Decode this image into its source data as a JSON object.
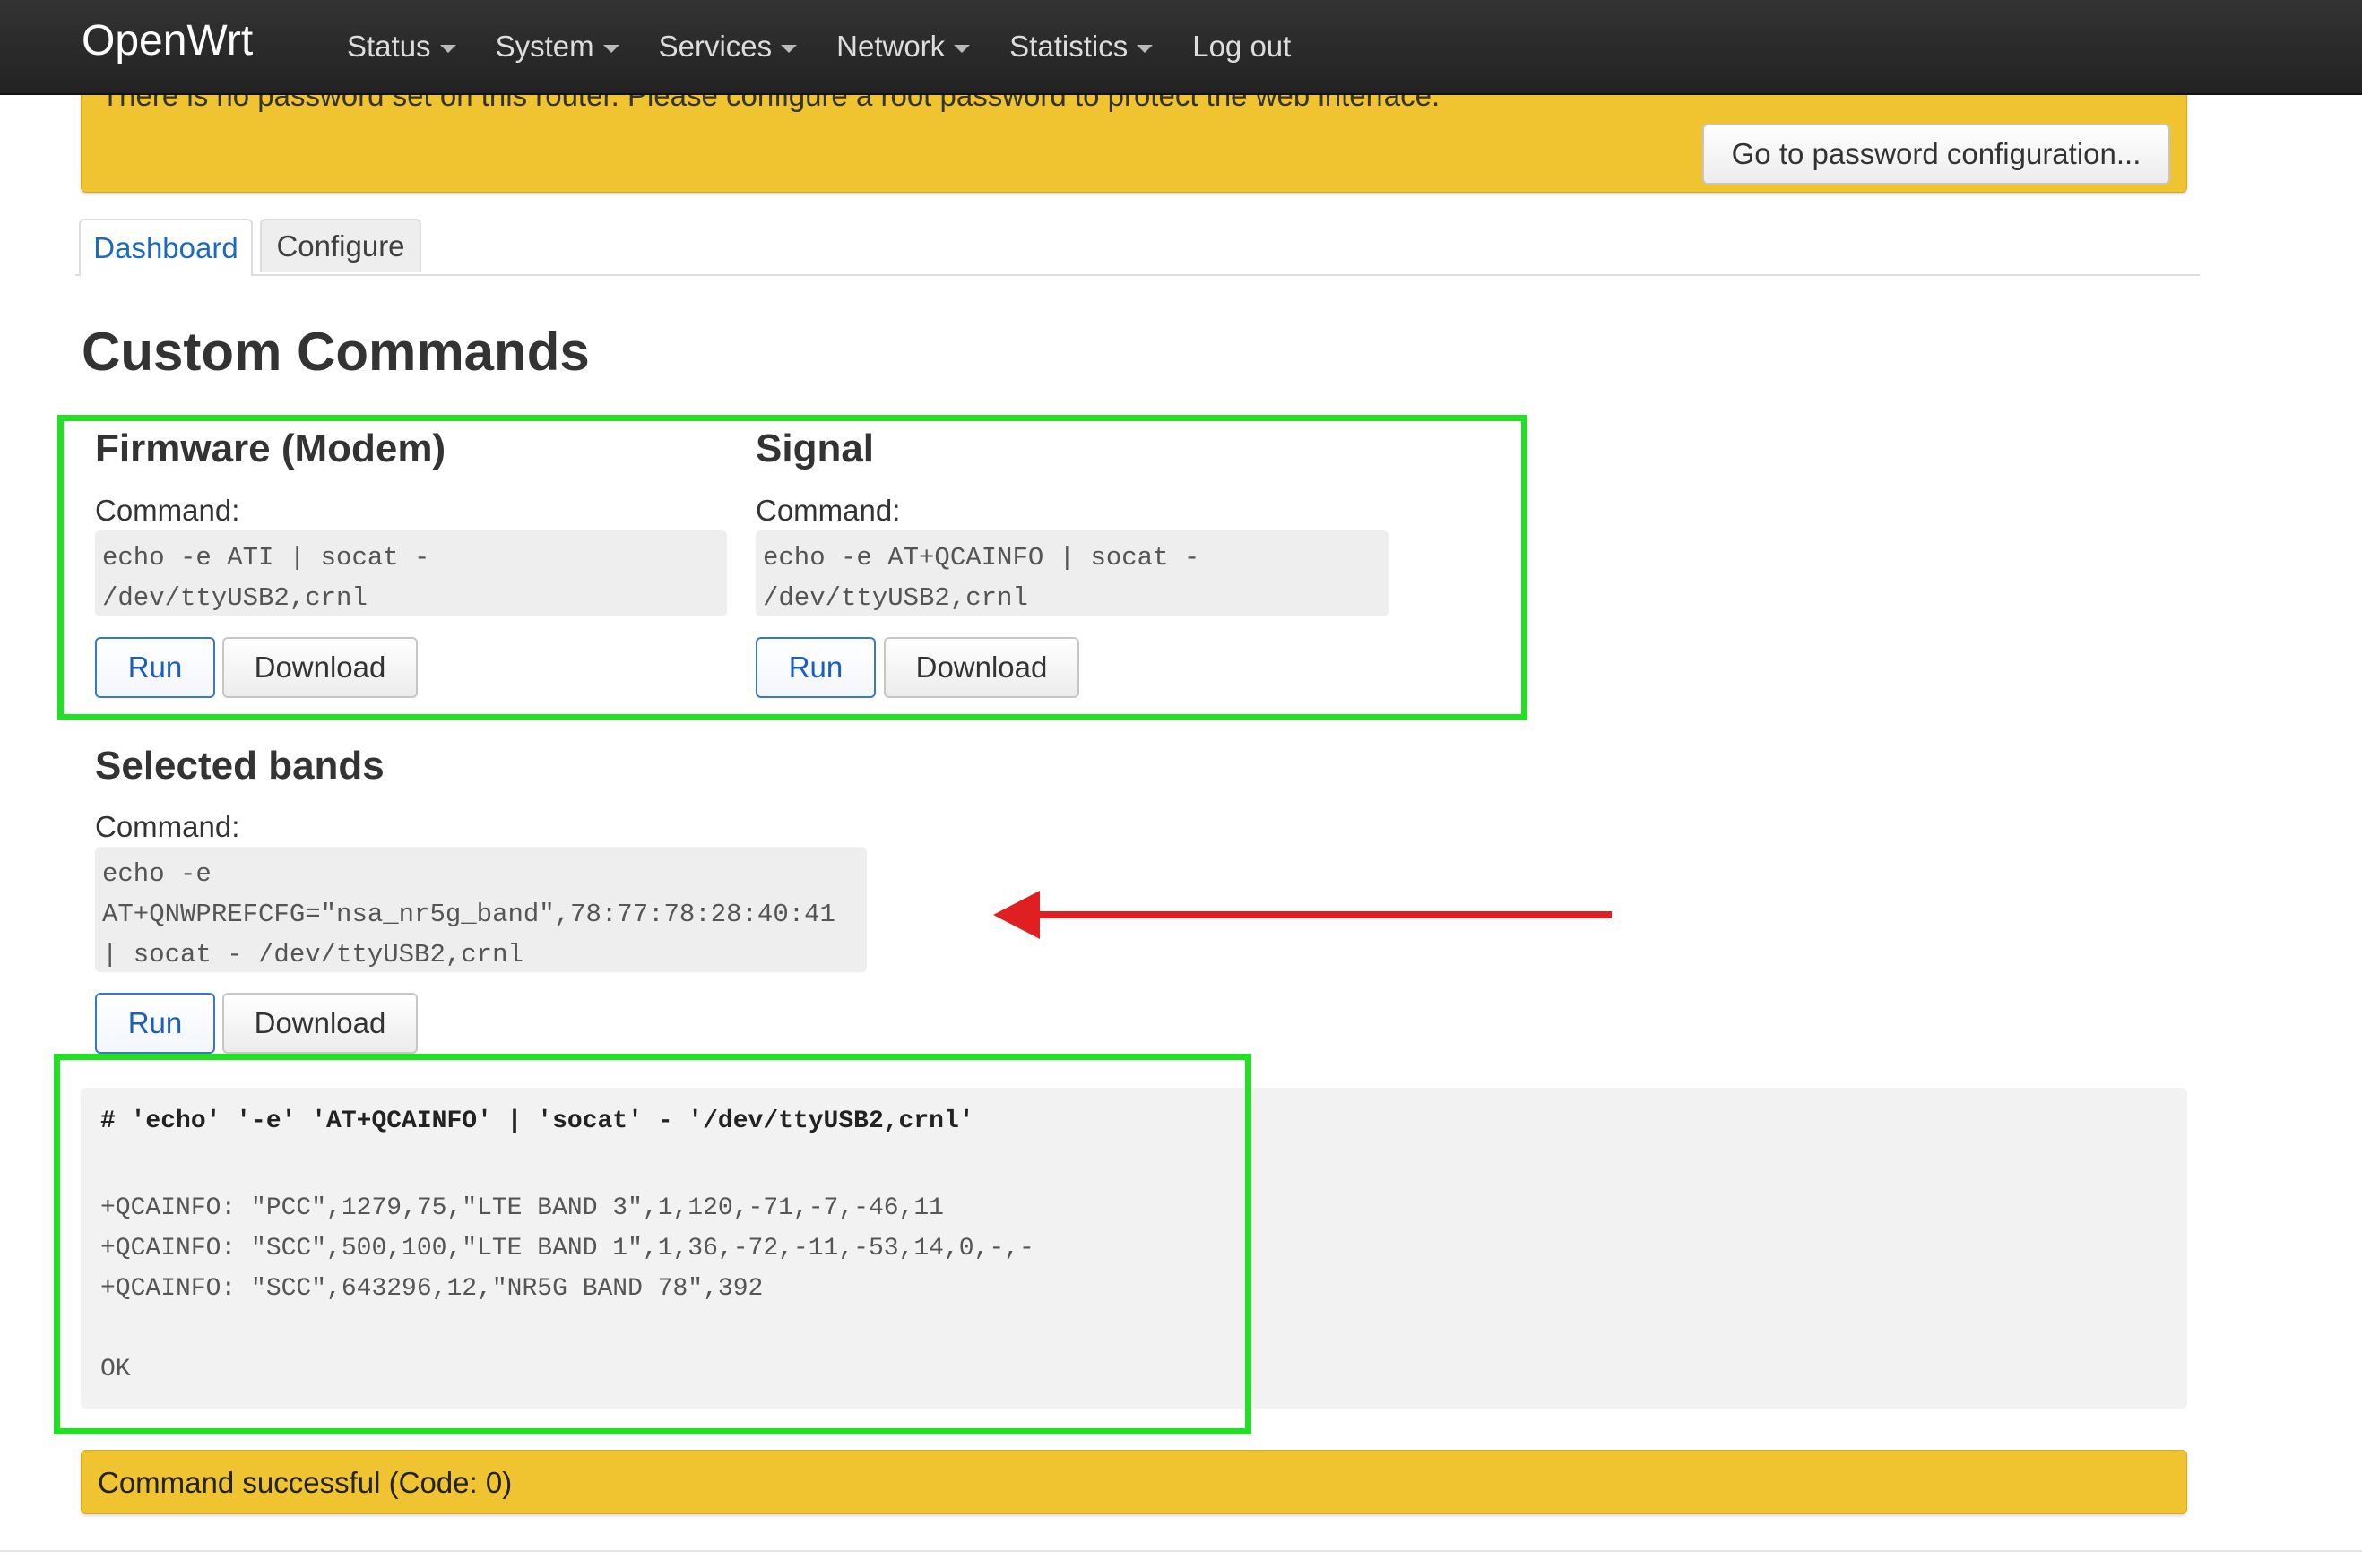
{
  "navbar": {
    "brand": "OpenWrt",
    "menu": [
      {
        "label": "Status",
        "dropdown": true
      },
      {
        "label": "System",
        "dropdown": true
      },
      {
        "label": "Services",
        "dropdown": true
      },
      {
        "label": "Network",
        "dropdown": true
      },
      {
        "label": "Statistics",
        "dropdown": true
      },
      {
        "label": "Log out",
        "dropdown": false
      }
    ]
  },
  "warning": {
    "message": "There is no password set on this router. Please configure a root password to protect the web interface.",
    "button_label": "Go to password configuration..."
  },
  "tabs": {
    "dashboard": "Dashboard",
    "configure": "Configure",
    "active": "Dashboard"
  },
  "page_title": "Custom Commands",
  "commands": {
    "firmware": {
      "title": "Firmware (Modem)",
      "label": "Command:",
      "command": "echo -e ATI | socat -\n/dev/ttyUSB2,crnl",
      "run": "Run",
      "download": "Download"
    },
    "signal": {
      "title": "Signal",
      "label": "Command:",
      "command": "echo -e AT+QCAINFO | socat -\n/dev/ttyUSB2,crnl",
      "run": "Run",
      "download": "Download"
    },
    "bands": {
      "title": "Selected bands",
      "label": "Command:",
      "command": "echo -e\nAT+QNWPREFCFG=\"nsa_nr5g_band\",78:77:78:28:40:41\n| socat - /dev/ttyUSB2,crnl",
      "run": "Run",
      "download": "Download"
    }
  },
  "output": {
    "command_line": "# 'echo' '-e' 'AT+QCAINFO' | 'socat' - '/dev/ttyUSB2,crnl'",
    "lines": "+QCAINFO: \"PCC\",1279,75,\"LTE BAND 3\",1,120,-71,-7,-46,11\n+QCAINFO: \"SCC\",500,100,\"LTE BAND 1\",1,36,-72,-11,-53,14,0,-,-\n+QCAINFO: \"SCC\",643296,12,\"NR5G BAND 78\",392\n\nOK"
  },
  "status": {
    "text": "Command successful (Code: 0)"
  },
  "colors": {
    "navbar": "#222222",
    "warning": "#f0c330",
    "accent_link": "#1a6bbf",
    "annotation_box": "#22e024",
    "annotation_arrow": "#e02020"
  }
}
